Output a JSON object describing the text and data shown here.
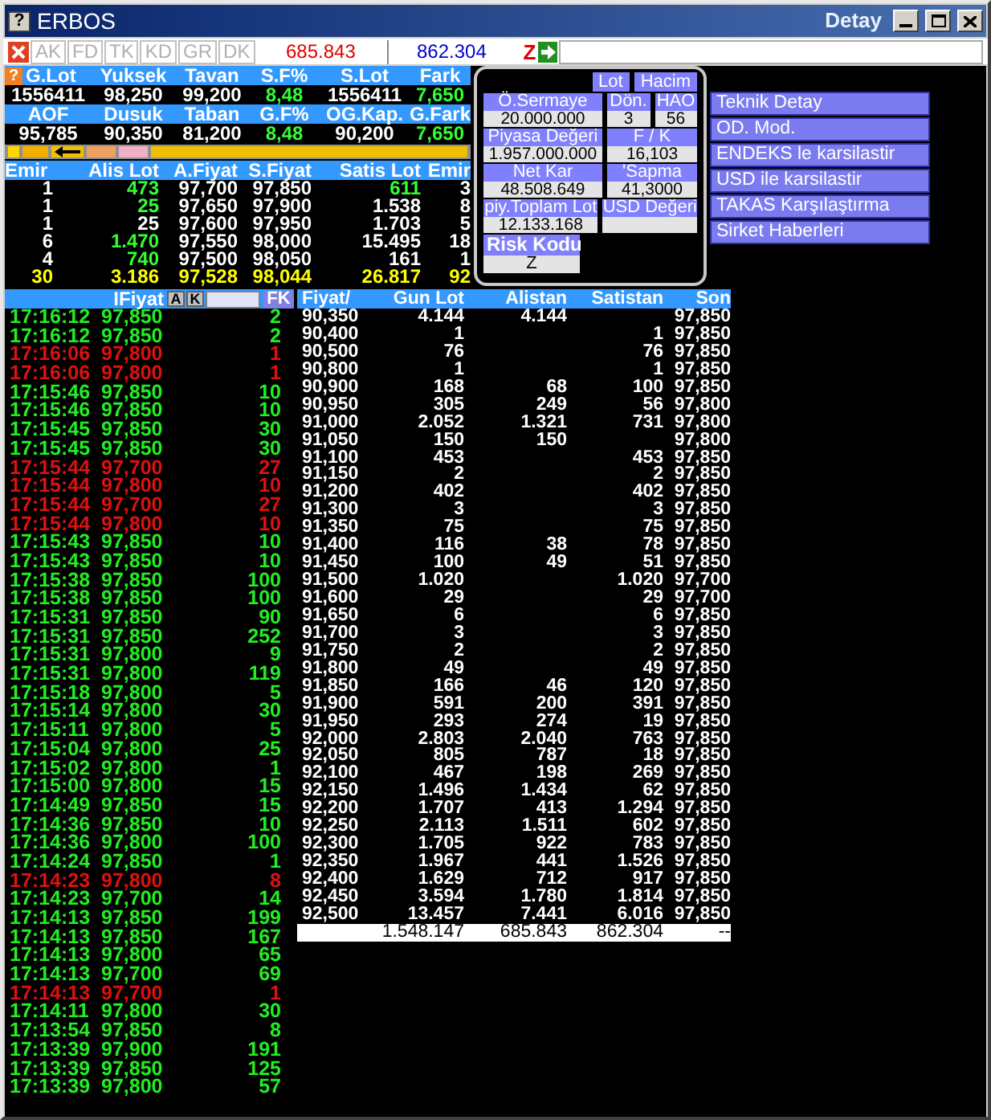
{
  "window": {
    "help": "?",
    "title": "ERBOS",
    "subtitle": "Detay"
  },
  "stats_help": "?",
  "toolbar": {
    "tabs": [
      {
        "label": "AK",
        "disabled": true
      },
      {
        "label": "FD",
        "disabled": true
      },
      {
        "label": "TK",
        "disabled": true
      },
      {
        "label": "KD",
        "disabled": true
      },
      {
        "label": "GR",
        "disabled": true
      },
      {
        "label": "DK",
        "disabled": true
      }
    ],
    "buy_total": "685.843",
    "sell_total": "862.304",
    "risk": "Z"
  },
  "stats": [
    {
      "labels": [
        "G.Lot",
        "Yuksek",
        "Tavan",
        "S.F%",
        "S.Lot",
        "Fark"
      ],
      "values": [
        {
          "text": "1556411",
          "highlighted": false
        },
        {
          "text": "98,250",
          "highlighted": false
        },
        {
          "text": "99,200",
          "highlighted": false
        },
        {
          "text": "8,48",
          "highlighted": true
        },
        {
          "text": "1556411",
          "highlighted": false
        },
        {
          "text": "7,650",
          "highlighted": true
        }
      ]
    },
    {
      "labels": [
        "AOF",
        "Dusuk",
        "Taban",
        "G.F%",
        "OG.Kap.",
        "G.Fark"
      ],
      "values": [
        {
          "text": "95,785",
          "highlighted": false
        },
        {
          "text": "90,350",
          "highlighted": false
        },
        {
          "text": "81,200",
          "highlighted": false
        },
        {
          "text": "8,48",
          "highlighted": true
        },
        {
          "text": "90,200",
          "highlighted": false
        },
        {
          "text": "7,650",
          "highlighted": true
        }
      ]
    }
  ],
  "order_book": {
    "columns": [
      "Emir",
      "Alis Lot",
      "A.Fiyat",
      "S.Fiyat",
      "Satis Lot",
      "Emir"
    ],
    "rows": [
      {
        "kind": "level",
        "cells": [
          "1",
          "473",
          "97,700",
          "97,850",
          "611",
          "3"
        ],
        "alis_highlighted": true,
        "satis_highlighted": true
      },
      {
        "kind": "level",
        "cells": [
          "1",
          "25",
          "97,650",
          "97,900",
          "1.538",
          "8"
        ],
        "alis_highlighted": true,
        "satis_highlighted": false
      },
      {
        "kind": "level",
        "cells": [
          "1",
          "25",
          "97,600",
          "97,950",
          "1.703",
          "5"
        ],
        "alis_highlighted": false,
        "satis_highlighted": false
      },
      {
        "kind": "level",
        "cells": [
          "6",
          "1.470",
          "97,550",
          "98,000",
          "15.495",
          "18"
        ],
        "alis_highlighted": true,
        "satis_highlighted": false
      },
      {
        "kind": "level",
        "cells": [
          "4",
          "740",
          "97,500",
          "98,050",
          "161",
          "1"
        ],
        "alis_highlighted": true,
        "satis_highlighted": false
      },
      {
        "kind": "total",
        "cells": [
          "30",
          "3.186",
          "97,528",
          "98,044",
          "26.817",
          "92"
        ]
      }
    ]
  },
  "fundamentals": {
    "buttons": [
      "Lot",
      "Hacim"
    ],
    "rows": [
      [
        {
          "label": "Ö.Sermaye",
          "value": "20.000.000"
        },
        {
          "label": "Dön.",
          "value": "3"
        },
        {
          "label": "HAO",
          "value": "56"
        }
      ],
      [
        {
          "label": "Piyasa Değeri",
          "value": "1.957.000.000"
        },
        {
          "label": "F / K",
          "value": "16,103"
        }
      ],
      [
        {
          "label": "Net Kar",
          "value": "48.508.649"
        },
        {
          "label": "'Sapma",
          "value": "41,3000"
        }
      ],
      [
        {
          "label": "piy.Toplam Lot",
          "value": "12.133.168"
        },
        {
          "label": "USD Değeri"
        }
      ]
    ],
    "risk": {
      "label": "Risk Kodu",
      "value": "Z"
    }
  },
  "menu": [
    "Teknik Detay",
    "OD. Mod.",
    "ENDEKS le karsilastir",
    "USD ile karsilastir",
    "TAKAS Karşılaştırma",
    "Sirket Haberleri"
  ],
  "trades": {
    "header": "IFiyat",
    "buttons": [
      "A",
      "K"
    ],
    "filter_button": "FK",
    "rows": [
      {
        "time": "17:16:12",
        "price": "97,850",
        "lot": "2",
        "uptick": true
      },
      {
        "time": "17:16:12",
        "price": "97,850",
        "lot": "2",
        "uptick": true
      },
      {
        "time": "17:16:06",
        "price": "97,800",
        "lot": "1",
        "uptick": false
      },
      {
        "time": "17:16:06",
        "price": "97,800",
        "lot": "1",
        "uptick": false
      },
      {
        "time": "17:15:46",
        "price": "97,850",
        "lot": "10",
        "uptick": true
      },
      {
        "time": "17:15:46",
        "price": "97,850",
        "lot": "10",
        "uptick": true
      },
      {
        "time": "17:15:45",
        "price": "97,850",
        "lot": "30",
        "uptick": true
      },
      {
        "time": "17:15:45",
        "price": "97,850",
        "lot": "30",
        "uptick": true
      },
      {
        "time": "17:15:44",
        "price": "97,700",
        "lot": "27",
        "uptick": false
      },
      {
        "time": "17:15:44",
        "price": "97,800",
        "lot": "10",
        "uptick": false
      },
      {
        "time": "17:15:44",
        "price": "97,700",
        "lot": "27",
        "uptick": false
      },
      {
        "time": "17:15:44",
        "price": "97,800",
        "lot": "10",
        "uptick": false
      },
      {
        "time": "17:15:43",
        "price": "97,850",
        "lot": "10",
        "uptick": true
      },
      {
        "time": "17:15:43",
        "price": "97,850",
        "lot": "10",
        "uptick": true
      },
      {
        "time": "17:15:38",
        "price": "97,850",
        "lot": "100",
        "uptick": true
      },
      {
        "time": "17:15:38",
        "price": "97,850",
        "lot": "100",
        "uptick": true
      },
      {
        "time": "17:15:31",
        "price": "97,850",
        "lot": "90",
        "uptick": true
      },
      {
        "time": "17:15:31",
        "price": "97,850",
        "lot": "252",
        "uptick": true
      },
      {
        "time": "17:15:31",
        "price": "97,800",
        "lot": "9",
        "uptick": true
      },
      {
        "time": "17:15:31",
        "price": "97,800",
        "lot": "119",
        "uptick": true
      },
      {
        "time": "17:15:18",
        "price": "97,800",
        "lot": "5",
        "uptick": true
      },
      {
        "time": "17:15:14",
        "price": "97,800",
        "lot": "30",
        "uptick": true
      },
      {
        "time": "17:15:11",
        "price": "97,800",
        "lot": "5",
        "uptick": true
      },
      {
        "time": "17:15:04",
        "price": "97,800",
        "lot": "25",
        "uptick": true
      },
      {
        "time": "17:15:02",
        "price": "97,800",
        "lot": "1",
        "uptick": true
      },
      {
        "time": "17:15:00",
        "price": "97,800",
        "lot": "15",
        "uptick": true
      },
      {
        "time": "17:14:49",
        "price": "97,850",
        "lot": "15",
        "uptick": true
      },
      {
        "time": "17:14:36",
        "price": "97,850",
        "lot": "10",
        "uptick": true
      },
      {
        "time": "17:14:36",
        "price": "97,800",
        "lot": "100",
        "uptick": true
      },
      {
        "time": "17:14:24",
        "price": "97,850",
        "lot": "1",
        "uptick": true
      },
      {
        "time": "17:14:23",
        "price": "97,800",
        "lot": "8",
        "uptick": false
      },
      {
        "time": "17:14:23",
        "price": "97,700",
        "lot": "14",
        "uptick": true
      },
      {
        "time": "17:14:13",
        "price": "97,850",
        "lot": "199",
        "uptick": true
      },
      {
        "time": "17:14:13",
        "price": "97,850",
        "lot": "167",
        "uptick": true
      },
      {
        "time": "17:14:13",
        "price": "97,800",
        "lot": "65",
        "uptick": true
      },
      {
        "time": "17:14:13",
        "price": "97,700",
        "lot": "69",
        "uptick": true
      },
      {
        "time": "17:14:13",
        "price": "97,700",
        "lot": "1",
        "uptick": false
      },
      {
        "time": "17:14:11",
        "price": "97,800",
        "lot": "30",
        "uptick": true
      },
      {
        "time": "17:13:54",
        "price": "97,850",
        "lot": "8",
        "uptick": true
      },
      {
        "time": "17:13:39",
        "price": "97,900",
        "lot": "191",
        "uptick": true
      },
      {
        "time": "17:13:39",
        "price": "97,850",
        "lot": "125",
        "uptick": true
      },
      {
        "time": "17:13:39",
        "price": "97,800",
        "lot": "57",
        "uptick": true
      }
    ]
  },
  "price_table": {
    "columns": [
      "Fiyat/",
      "Gun Lot",
      "Alistan",
      "Satistan",
      "Son"
    ],
    "rows": [
      [
        "90,350",
        "4.144",
        "4.144",
        "",
        "97,850"
      ],
      [
        "90,400",
        "1",
        "",
        "1",
        "97,850"
      ],
      [
        "90,500",
        "76",
        "",
        "76",
        "97,850"
      ],
      [
        "90,800",
        "1",
        "",
        "1",
        "97,850"
      ],
      [
        "90,900",
        "168",
        "68",
        "100",
        "97,850"
      ],
      [
        "90,950",
        "305",
        "249",
        "56",
        "97,800"
      ],
      [
        "91,000",
        "2.052",
        "1.321",
        "731",
        "97,800"
      ],
      [
        "91,050",
        "150",
        "150",
        "",
        "97,800"
      ],
      [
        "91,100",
        "453",
        "",
        "453",
        "97,850"
      ],
      [
        "91,150",
        "2",
        "",
        "2",
        "97,850"
      ],
      [
        "91,200",
        "402",
        "",
        "402",
        "97,850"
      ],
      [
        "91,300",
        "3",
        "",
        "3",
        "97,850"
      ],
      [
        "91,350",
        "75",
        "",
        "75",
        "97,850"
      ],
      [
        "91,400",
        "116",
        "38",
        "78",
        "97,850"
      ],
      [
        "91,450",
        "100",
        "49",
        "51",
        "97,850"
      ],
      [
        "91,500",
        "1.020",
        "",
        "1.020",
        "97,700"
      ],
      [
        "91,600",
        "29",
        "",
        "29",
        "97,700"
      ],
      [
        "91,650",
        "6",
        "",
        "6",
        "97,850"
      ],
      [
        "91,700",
        "3",
        "",
        "3",
        "97,850"
      ],
      [
        "91,750",
        "2",
        "",
        "2",
        "97,850"
      ],
      [
        "91,800",
        "49",
        "",
        "49",
        "97,850"
      ],
      [
        "91,850",
        "166",
        "46",
        "120",
        "97,850"
      ],
      [
        "91,900",
        "591",
        "200",
        "391",
        "97,850"
      ],
      [
        "91,950",
        "293",
        "274",
        "19",
        "97,850"
      ],
      [
        "92,000",
        "2.803",
        "2.040",
        "763",
        "97,850"
      ],
      [
        "92,050",
        "805",
        "787",
        "18",
        "97,850"
      ],
      [
        "92,100",
        "467",
        "198",
        "269",
        "97,850"
      ],
      [
        "92,150",
        "1.496",
        "1.434",
        "62",
        "97,850"
      ],
      [
        "92,200",
        "1.707",
        "413",
        "1.294",
        "97,850"
      ],
      [
        "92,250",
        "2.113",
        "1.511",
        "602",
        "97,850"
      ],
      [
        "92,300",
        "1.705",
        "922",
        "783",
        "97,850"
      ],
      [
        "92,350",
        "1.967",
        "441",
        "1.526",
        "97,850"
      ],
      [
        "92,400",
        "1.629",
        "712",
        "917",
        "97,850"
      ],
      [
        "92,450",
        "3.594",
        "1.780",
        "1.814",
        "97,850"
      ],
      [
        "92,500",
        "13.457",
        "7.441",
        "6.016",
        "97,850"
      ]
    ],
    "totals": [
      "1.548.147",
      "685.843",
      "862.304",
      "--"
    ]
  }
}
